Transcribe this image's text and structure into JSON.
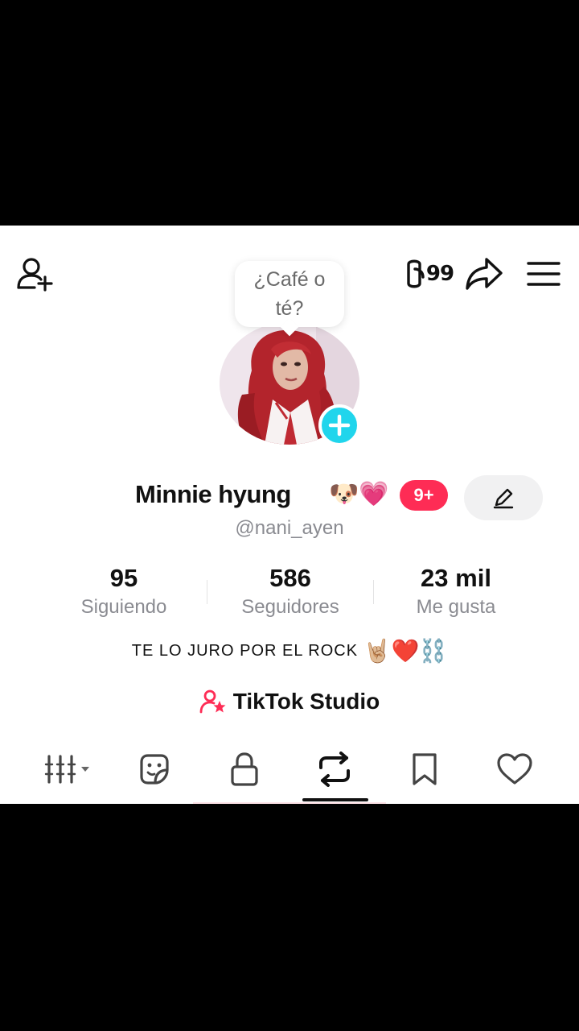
{
  "profile": {
    "note_text": "¿Café o té?",
    "display_name": "Minnie hyung",
    "name_emojis": "🐶💗",
    "notification_badge": "9+",
    "username": "@nani_ayen",
    "bio_text": "TE LO JURO POR EL ROCK",
    "bio_emojis": "🤘🏼❤️⛓️"
  },
  "topbar": {
    "streak_value": "99"
  },
  "stats": [
    {
      "value": "95",
      "label": "Siguiendo"
    },
    {
      "value": "586",
      "label": "Seguidores"
    },
    {
      "value": "23 mil",
      "label": "Me gusta"
    }
  ],
  "studio": {
    "label": "TikTok Studio"
  },
  "tabs": [
    {
      "icon": "grid-icon",
      "active": false
    },
    {
      "icon": "sticker-icon",
      "active": false
    },
    {
      "icon": "lock-icon",
      "active": false
    },
    {
      "icon": "repost-icon",
      "active": true
    },
    {
      "icon": "bookmark-icon",
      "active": false
    },
    {
      "icon": "heart-icon",
      "active": false
    }
  ],
  "colors": {
    "accent_pink": "#fe2c55",
    "accent_cyan": "#20d5ec",
    "muted_text": "#8a8b91"
  }
}
